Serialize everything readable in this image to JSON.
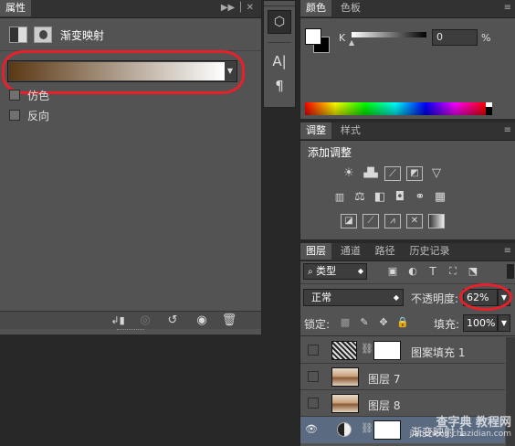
{
  "properties": {
    "tab": "属性",
    "title": "渐变映射",
    "dither": "仿色",
    "reverse": "反向",
    "gradient_from": "#5a3814",
    "gradient_to": "#ffffff",
    "panel_menu": "▶▶ │ ✕",
    "footer_icons": [
      "clip-to-layer-icon",
      "view-previous-icon",
      "reset-icon",
      "visibility-icon",
      "delete-icon"
    ]
  },
  "tools": {
    "items": [
      "3d-icon",
      "character-icon",
      "paragraph-icon"
    ],
    "character_glyph": "A|",
    "paragraph_glyph": "¶"
  },
  "color": {
    "tabs": [
      "颜色",
      "色板"
    ],
    "channel": "K",
    "value": "0",
    "unit": "%"
  },
  "adjustments": {
    "tabs": [
      "调整",
      "样式"
    ],
    "title": "添加调整",
    "icons": [
      [
        "brightness-icon",
        "levels-icon",
        "curves-icon",
        "exposure-icon",
        "vibrance-icon"
      ],
      [
        "hue-saturation-icon",
        "color-balance-icon",
        "black-white-icon",
        "photo-filter-icon",
        "channel-mixer-icon",
        "color-lookup-icon"
      ],
      [
        "invert-icon",
        "posterize-icon",
        "threshold-icon",
        "selective-color-icon",
        "gradient-map-icon"
      ]
    ]
  },
  "layers": {
    "tabs": [
      "图层",
      "通道",
      "路径",
      "历史记录"
    ],
    "filter_label": "类型",
    "blend_mode": "正常",
    "opacity_label": "不透明度:",
    "opacity_value": "62%",
    "lock_label": "锁定:",
    "fill_label": "填充:",
    "fill_value": "100%",
    "items": [
      {
        "name": "图案填充 1",
        "visible": false,
        "thumb": "pattern",
        "mask": true
      },
      {
        "name": "图层 7",
        "visible": false,
        "thumb": "photo",
        "mask": false
      },
      {
        "name": "图层 8",
        "visible": false,
        "thumb": "photo",
        "mask": false
      },
      {
        "name": "渐变映射 1",
        "visible": true,
        "thumb": "adjust",
        "mask": true
      }
    ]
  },
  "watermark": {
    "line1": "查字典 教程网",
    "line2": "jiaocheng.chazidian.com"
  }
}
